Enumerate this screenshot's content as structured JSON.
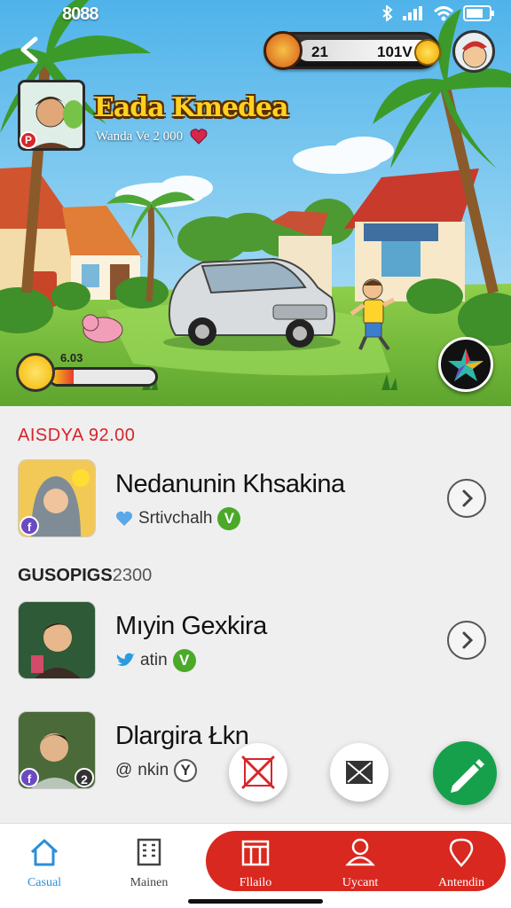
{
  "status": {
    "time": "8088"
  },
  "scoreboard": {
    "left_value": "21",
    "right_value": "101V"
  },
  "player": {
    "name": "Eada Kmedea",
    "subtitle": "Wanda Ve 2 000",
    "level_badge": "P"
  },
  "energy": {
    "label": "6.03",
    "fill_fraction": 0.22
  },
  "sections": [
    {
      "title": "AISDYA 92.00"
    },
    {
      "title": "GUSOPIGS",
      "count": "2300"
    }
  ],
  "friends": [
    {
      "name": "Nedanunin Khsakina",
      "sub": "Srtivchalh",
      "sub_icon": "heart-icon",
      "status": "V",
      "badge": "f"
    },
    {
      "name": "Mıyin Gexkira",
      "sub": "atin",
      "sub_icon": "twitter-bird-icon",
      "status": "V"
    },
    {
      "name": "Dlargira Łkn",
      "sub": "nkin",
      "sub_icon": "at-icon",
      "sub_prefix": "@",
      "status": "Y",
      "badge": "f",
      "count_badge": "2"
    }
  ],
  "nav": [
    {
      "label": "Casual",
      "icon": "home-icon",
      "active": true
    },
    {
      "label": "Mainen",
      "icon": "building-icon"
    },
    {
      "label": "Fllailo",
      "icon": "columns-icon"
    },
    {
      "label": "Uycant",
      "icon": "user-icon"
    },
    {
      "label": "Antendin",
      "icon": "map-pin-icon"
    }
  ],
  "colors": {
    "accent_red": "#d9281f",
    "accent_green": "#17a04b",
    "title_gold": "#ffd21f",
    "active_blue": "#2b8fd8"
  }
}
